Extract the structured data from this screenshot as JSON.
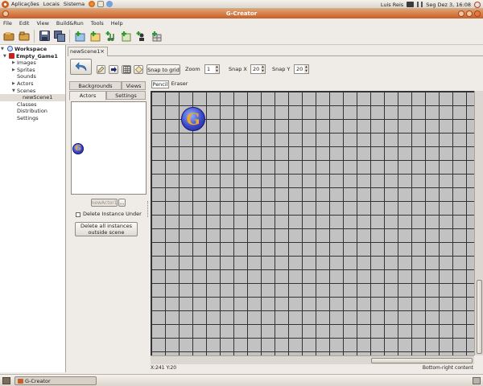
{
  "top_panel": {
    "menus": [
      "Aplicações",
      "Locais",
      "Sistema"
    ],
    "user": "Luis Reis",
    "clock": "Seg Dez  3, 16:08"
  },
  "window": {
    "title": "G-Creator"
  },
  "menu_bar": [
    "File",
    "Edit",
    "View",
    "Build&Run",
    "Tools",
    "Help"
  ],
  "toolbar": {
    "buttons": [
      "new-project",
      "open-project",
      "save",
      "save-all",
      "add-image",
      "add-sprite",
      "add-sound",
      "add-actor",
      "add-class",
      "add-scene"
    ]
  },
  "workspace_tree": {
    "root": "Workspace",
    "game": "Empty_Game1",
    "items": [
      "Images",
      "Sprites",
      "Sounds",
      "Actors",
      "Scenes"
    ],
    "scene_child": "newScene1",
    "tail_items": [
      "Classes",
      "Distribution",
      "Settings"
    ]
  },
  "scene_tab": {
    "label": "newScene1",
    "close": "×"
  },
  "scene_toolbar": {
    "snap_to_grid": "Snap to grid",
    "zoom_label": "Zoom",
    "zoom_value": "1",
    "snap_x_label": "Snap X",
    "snap_x_value": "20",
    "snap_y_label": "Snap Y",
    "snap_y_value": "20"
  },
  "resource_tabs": {
    "row1": [
      "Backgrounds",
      "Views"
    ],
    "row2": [
      "Actors",
      "Settings"
    ],
    "active": "Actors"
  },
  "actors_panel": {
    "new_actor_button": "newActor1",
    "browse_button": "...",
    "delete_instance_under": "Delete Instance Under",
    "delete_outside_line1": "Delete all instances",
    "delete_outside_line2": "outside scene"
  },
  "tool_tabs": [
    "Pencil",
    "Eraser"
  ],
  "canvas": {
    "actor_glyph": "G"
  },
  "status_bar": {
    "coords": "X:241 Y:20",
    "right_text": "Bottom-right content"
  },
  "taskbar": {
    "window_button": "G-Creator"
  },
  "colors": {
    "title_bar": "#c5602b",
    "canvas_bg": "#c2c2c2",
    "grid_line": "#333333"
  }
}
